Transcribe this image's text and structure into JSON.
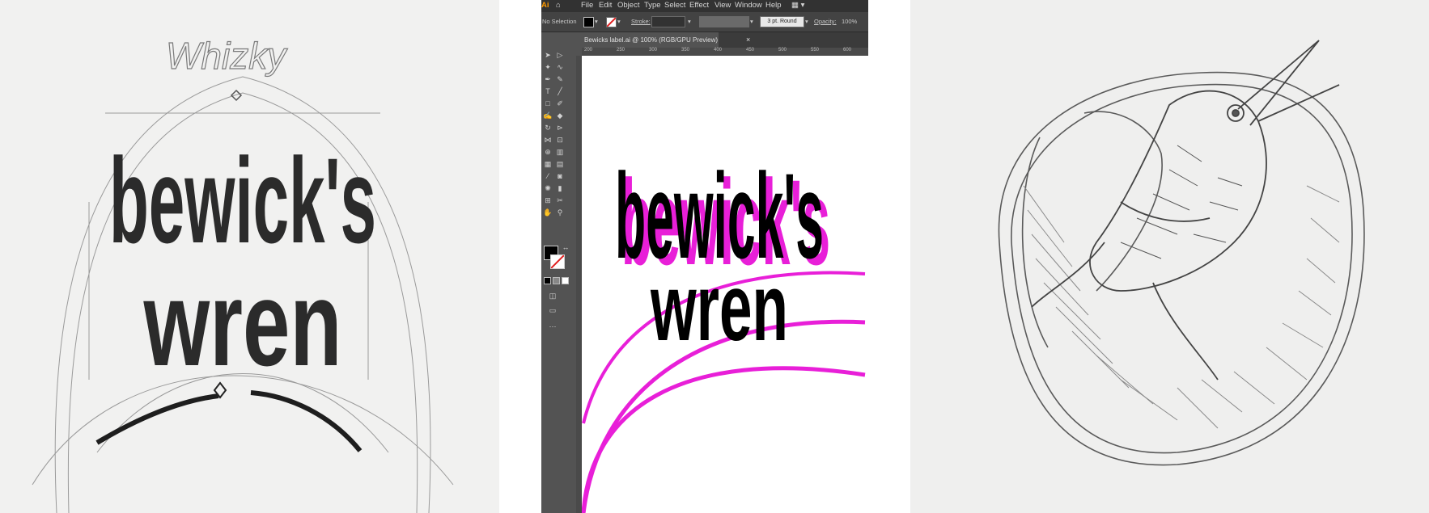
{
  "left_sketch": {
    "top_script": "Whizky",
    "line1": "bewick's",
    "line2": "wren"
  },
  "illustrator": {
    "menu": {
      "items": [
        "File",
        "Edit",
        "Object",
        "Type",
        "Select",
        "Effect",
        "View",
        "Window",
        "Help"
      ]
    },
    "control_bar": {
      "selection_label": "No Selection",
      "stroke_label": "Stroke:",
      "brush_value": "3 pt. Round",
      "opacity_label": "Opacity:",
      "opacity_value": "100%"
    },
    "document_tab": {
      "label": "Bewicks label.ai @ 100% (RGB/GPU Preview)",
      "close": "×"
    },
    "ruler_ticks": [
      "200",
      "250",
      "300",
      "350",
      "400",
      "450",
      "500",
      "550",
      "600"
    ],
    "artwork": {
      "line1": "bewick's",
      "line2": "wren"
    },
    "colors": {
      "magenta": "#e81fd8",
      "black": "#000000",
      "ui_dark": "#323232",
      "ui_mid": "#535353"
    },
    "icons": [
      "home-icon",
      "selection-tool-icon",
      "direct-selection-tool-icon",
      "pen-tool-icon",
      "type-tool-icon",
      "line-tool-icon",
      "rectangle-tool-icon",
      "paintbrush-tool-icon",
      "eraser-tool-icon",
      "rotate-tool-icon",
      "hand-tool-icon",
      "zoom-tool-icon",
      "fill-swatch-icon",
      "stroke-swatch-icon",
      "more-tools-icon"
    ]
  },
  "right_sketch": {
    "subject": "wren-in-nest-drawing"
  }
}
